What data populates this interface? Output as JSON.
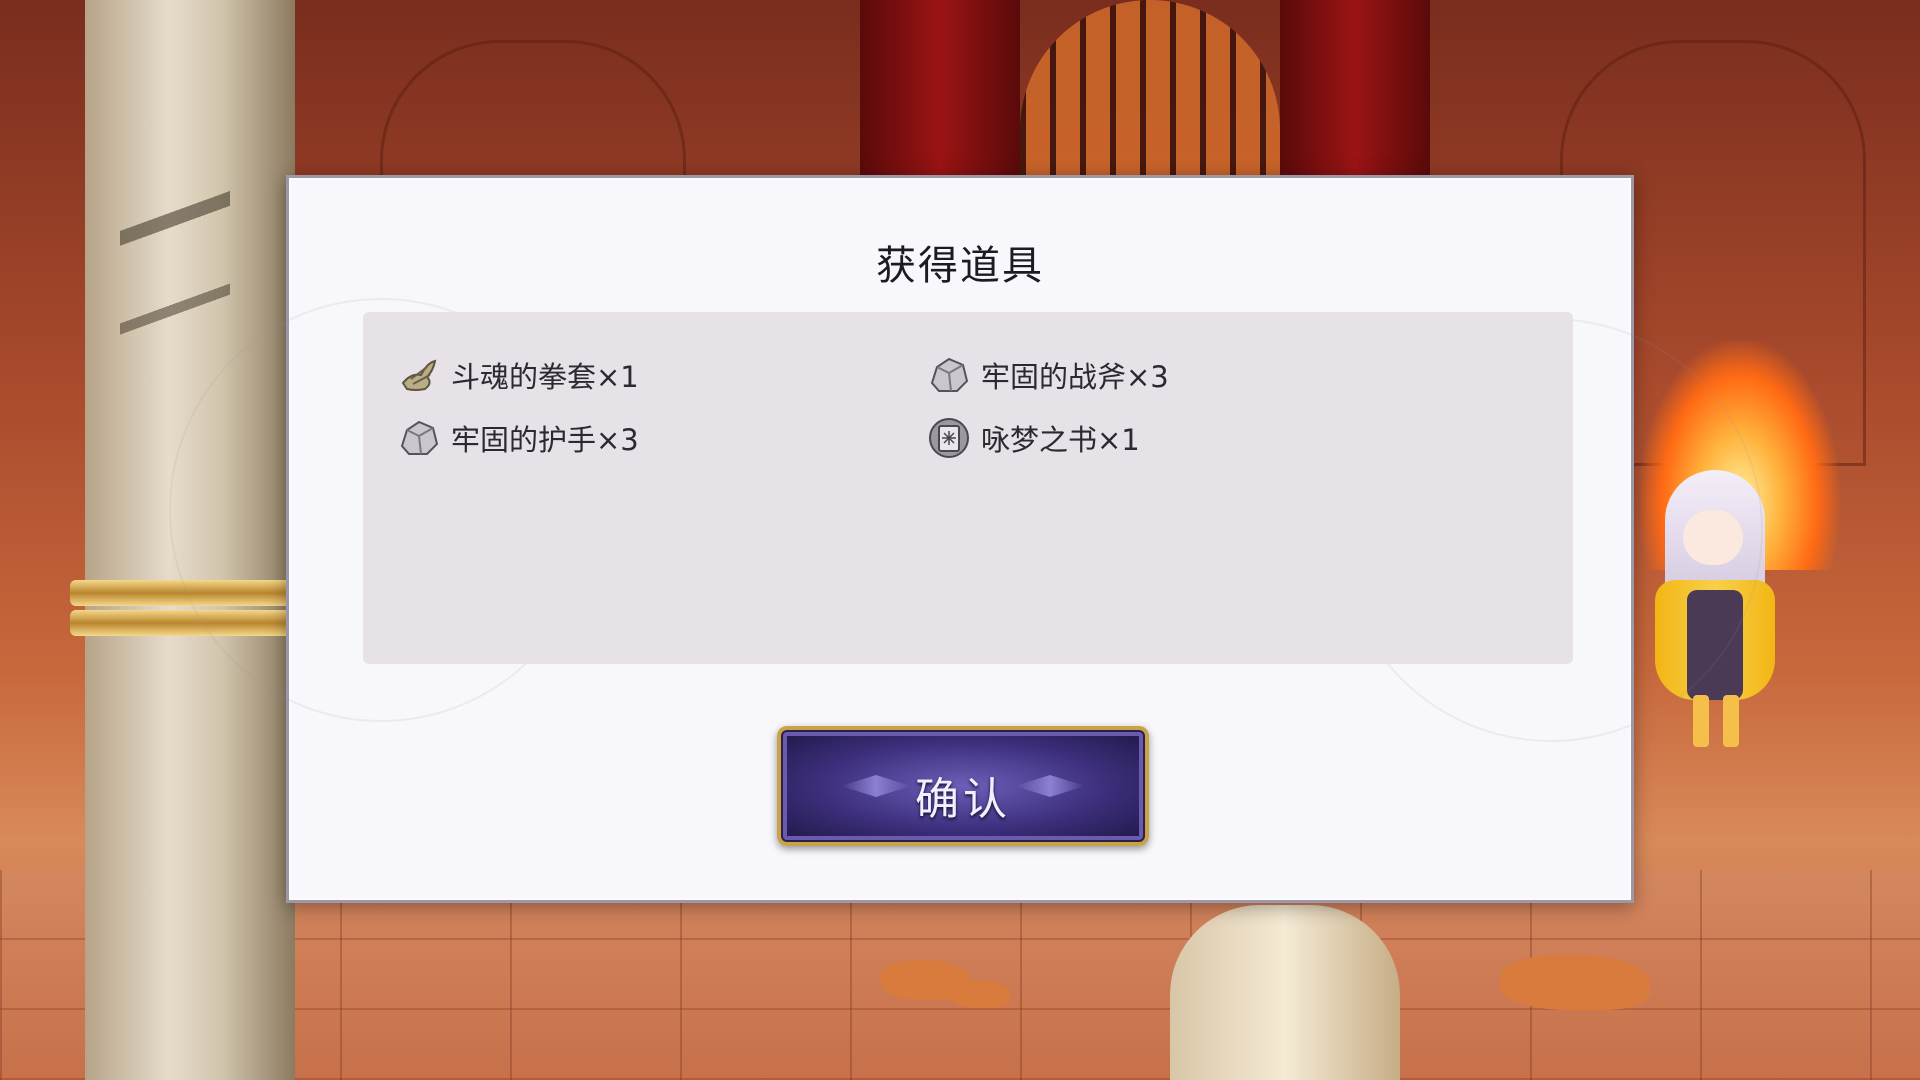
{
  "dialog": {
    "title": "获得道具",
    "confirm_label": "确认"
  },
  "items": [
    {
      "name": "斗魂的拳套×1",
      "icon": "gauntlet-icon"
    },
    {
      "name": "牢固的战斧×3",
      "icon": "ore-rock-icon"
    },
    {
      "name": "牢固的护手×3",
      "icon": "ore-rock-icon"
    },
    {
      "name": "咏梦之书×1",
      "icon": "book-icon"
    }
  ],
  "colors": {
    "dialog_bg": "#f8f7fb",
    "panel_bg": "#e6e2e7",
    "button_accent": "#3d2f7c",
    "button_border": "#c9a34a"
  }
}
